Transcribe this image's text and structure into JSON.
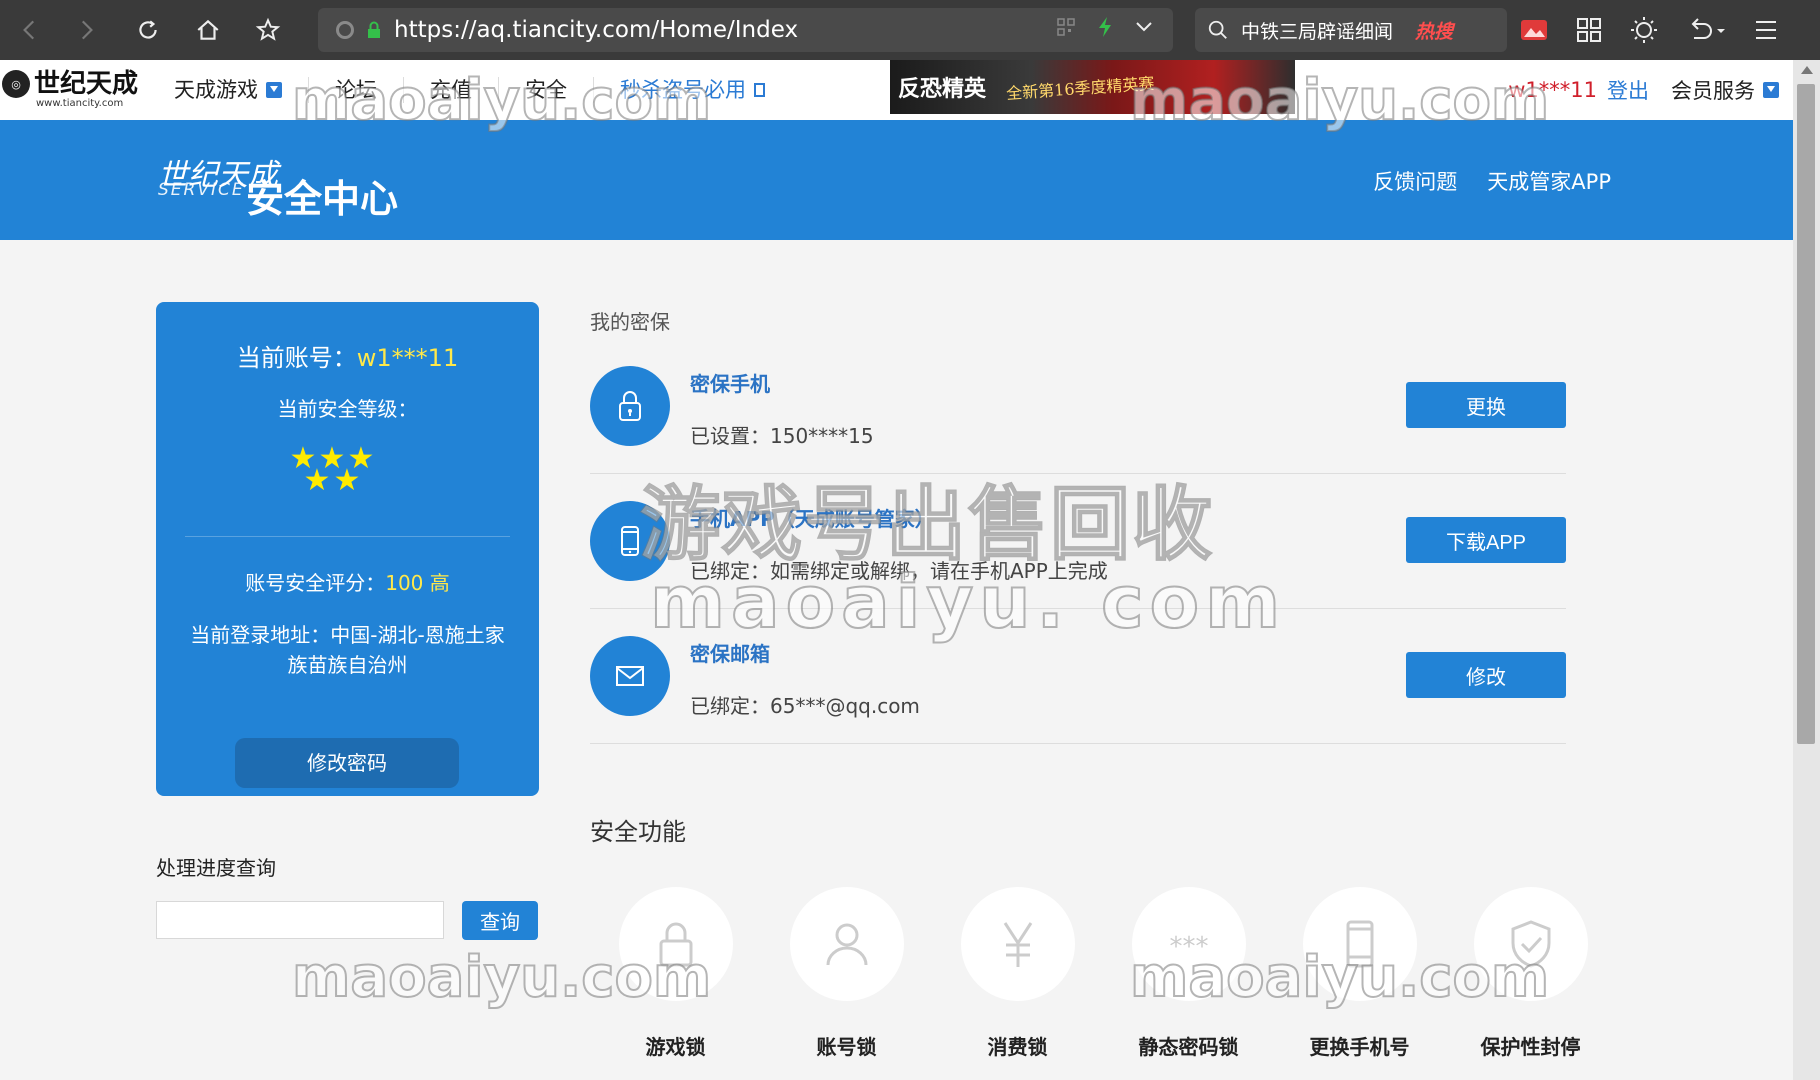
{
  "browser": {
    "url": "https://aq.tiancity.com/Home/Index",
    "search_query": "中铁三局辟谣细闻",
    "hot_label": "热搜"
  },
  "site": {
    "logo_text": "世纪天成",
    "logo_sub": "www.tiancity.com",
    "nav": [
      "天成游戏",
      "论坛",
      "充值",
      "安全"
    ],
    "promo": "秒杀盗号必用",
    "banner_title": "反恐精英",
    "banner_sub": "全新第16季度精英赛",
    "user": "w1***11",
    "logout": "登出",
    "member": "会员服务"
  },
  "header": {
    "brand_cn1": "世纪天成",
    "brand_en": "SERVICE",
    "brand_cn2": "安全中心",
    "links": [
      "反馈问题",
      "天成管家APP"
    ]
  },
  "account": {
    "label": "当前账号：",
    "value": "w1***11",
    "level_label": "当前安全等级：",
    "stars": 5,
    "score_label": "账号安全评分：",
    "score_value": "100 高",
    "address": "当前登录地址：中国-湖北-恩施土家族苗族自治州",
    "change_pwd": "修改密码"
  },
  "progress": {
    "title": "处理进度查询",
    "input_value": "",
    "button": "查询"
  },
  "security": {
    "title": "我的密保",
    "items": [
      {
        "icon": "lock-icon",
        "title": "密保手机",
        "desc": "已设置：150****15",
        "action": "更换"
      },
      {
        "icon": "phone-icon",
        "title": "手机APP（天成账号管家）",
        "desc": "已绑定：如需绑定或解绑，请在手机APP上完成",
        "action": "下载APP"
      },
      {
        "icon": "mail-icon",
        "title": "密保邮箱",
        "desc": "已绑定：65***@qq.com",
        "action": "修改"
      }
    ]
  },
  "features": {
    "title": "安全功能",
    "items": [
      {
        "icon": "lock-icon",
        "label": "游戏锁"
      },
      {
        "icon": "user-icon",
        "label": "账号锁"
      },
      {
        "icon": "yen-icon",
        "label": "消费锁"
      },
      {
        "icon": "asterisk-icon",
        "label": "静态密码锁"
      },
      {
        "icon": "phone-icon",
        "label": "更换手机号"
      },
      {
        "icon": "shield-icon",
        "label": "保护性封停"
      }
    ]
  },
  "watermarks": {
    "domain": "maoaiyu.com",
    "domain_spaced": "maoaiyu. com",
    "sale": "游戏号出售回收"
  },
  "colors": {
    "primary": "#2283d6",
    "highlight": "#ffe84a",
    "user_red": "#d01f2b"
  }
}
